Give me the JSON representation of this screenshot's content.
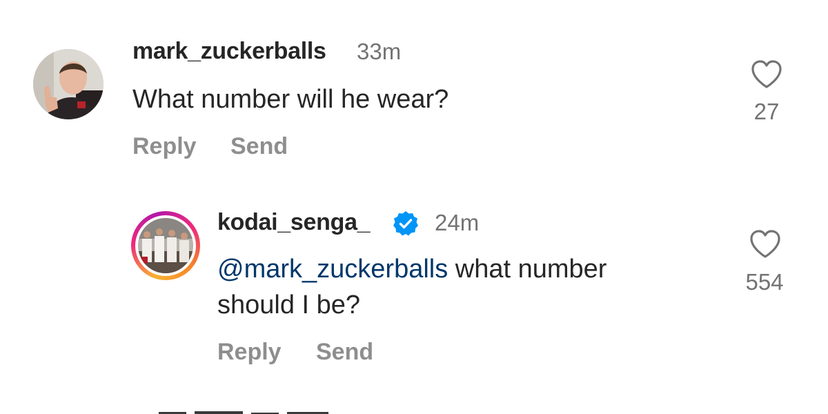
{
  "comments": [
    {
      "username": "mark_zuckerballs",
      "time": "33m",
      "text": "What number will he wear?",
      "likes": "27",
      "reply_label": "Reply",
      "send_label": "Send"
    },
    {
      "username": "kodai_senga_",
      "verified": true,
      "time": "24m",
      "mention": "@mark_zuckerballs",
      "text": " what number should I be?",
      "likes": "554",
      "reply_label": "Reply",
      "send_label": "Send"
    }
  ],
  "colors": {
    "username": "#262626",
    "muted": "#8e8e8e",
    "mention": "#00376b",
    "verified": "#0095f6"
  },
  "icons": {
    "like": "heart-outline-icon",
    "verified": "verified-badge-icon"
  }
}
